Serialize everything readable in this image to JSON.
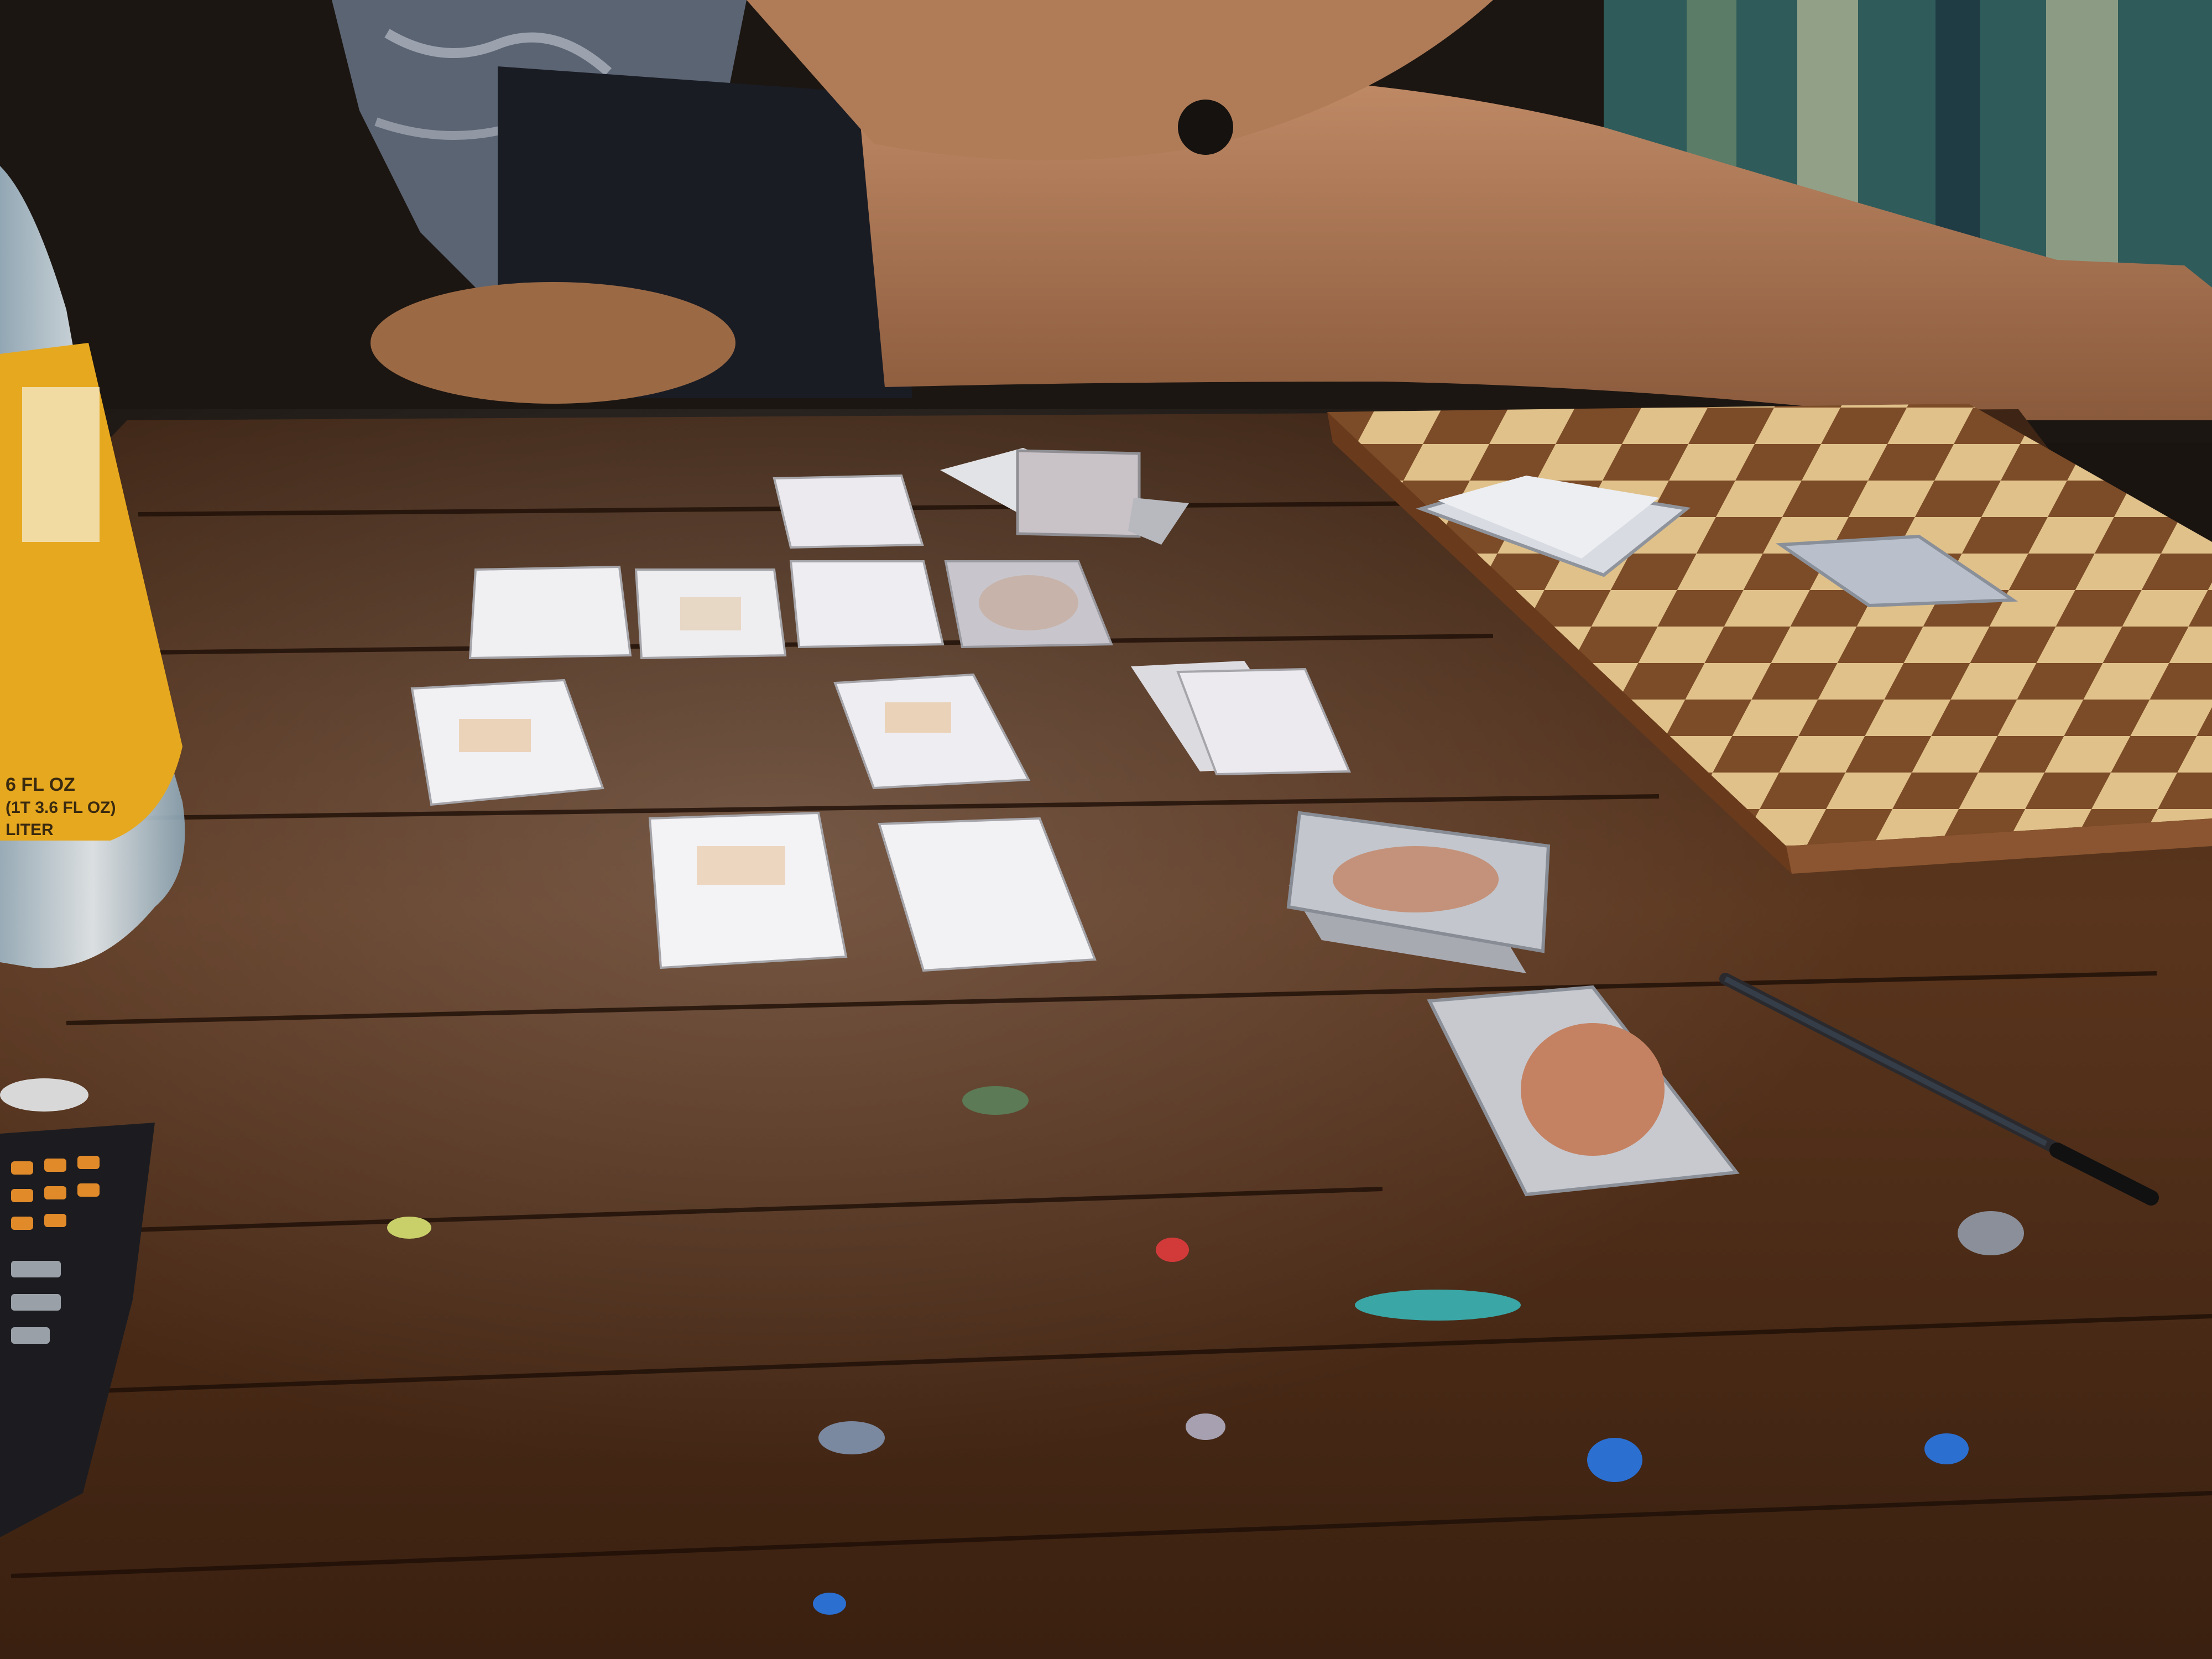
{
  "scene": {
    "colors": {
      "wall": "#1c1612",
      "couch_blanket": "#2f5b5a",
      "skin": "#b47a5a",
      "table_wood": "#4a2c1a",
      "table_dark": "#2b170d",
      "chess_light": "#e2c48e",
      "chess_dark": "#7a4a26",
      "card_white": "#e9e7ea",
      "card_back": "#c58262",
      "bottle_label": "#e6a81e"
    },
    "bottle": {
      "label_line_1": "6 FL OZ",
      "label_line_2": "(1T 3.6 FL OZ)",
      "label_line_3": "LITER"
    },
    "remote": {
      "icon": "remote-control-icon"
    }
  }
}
